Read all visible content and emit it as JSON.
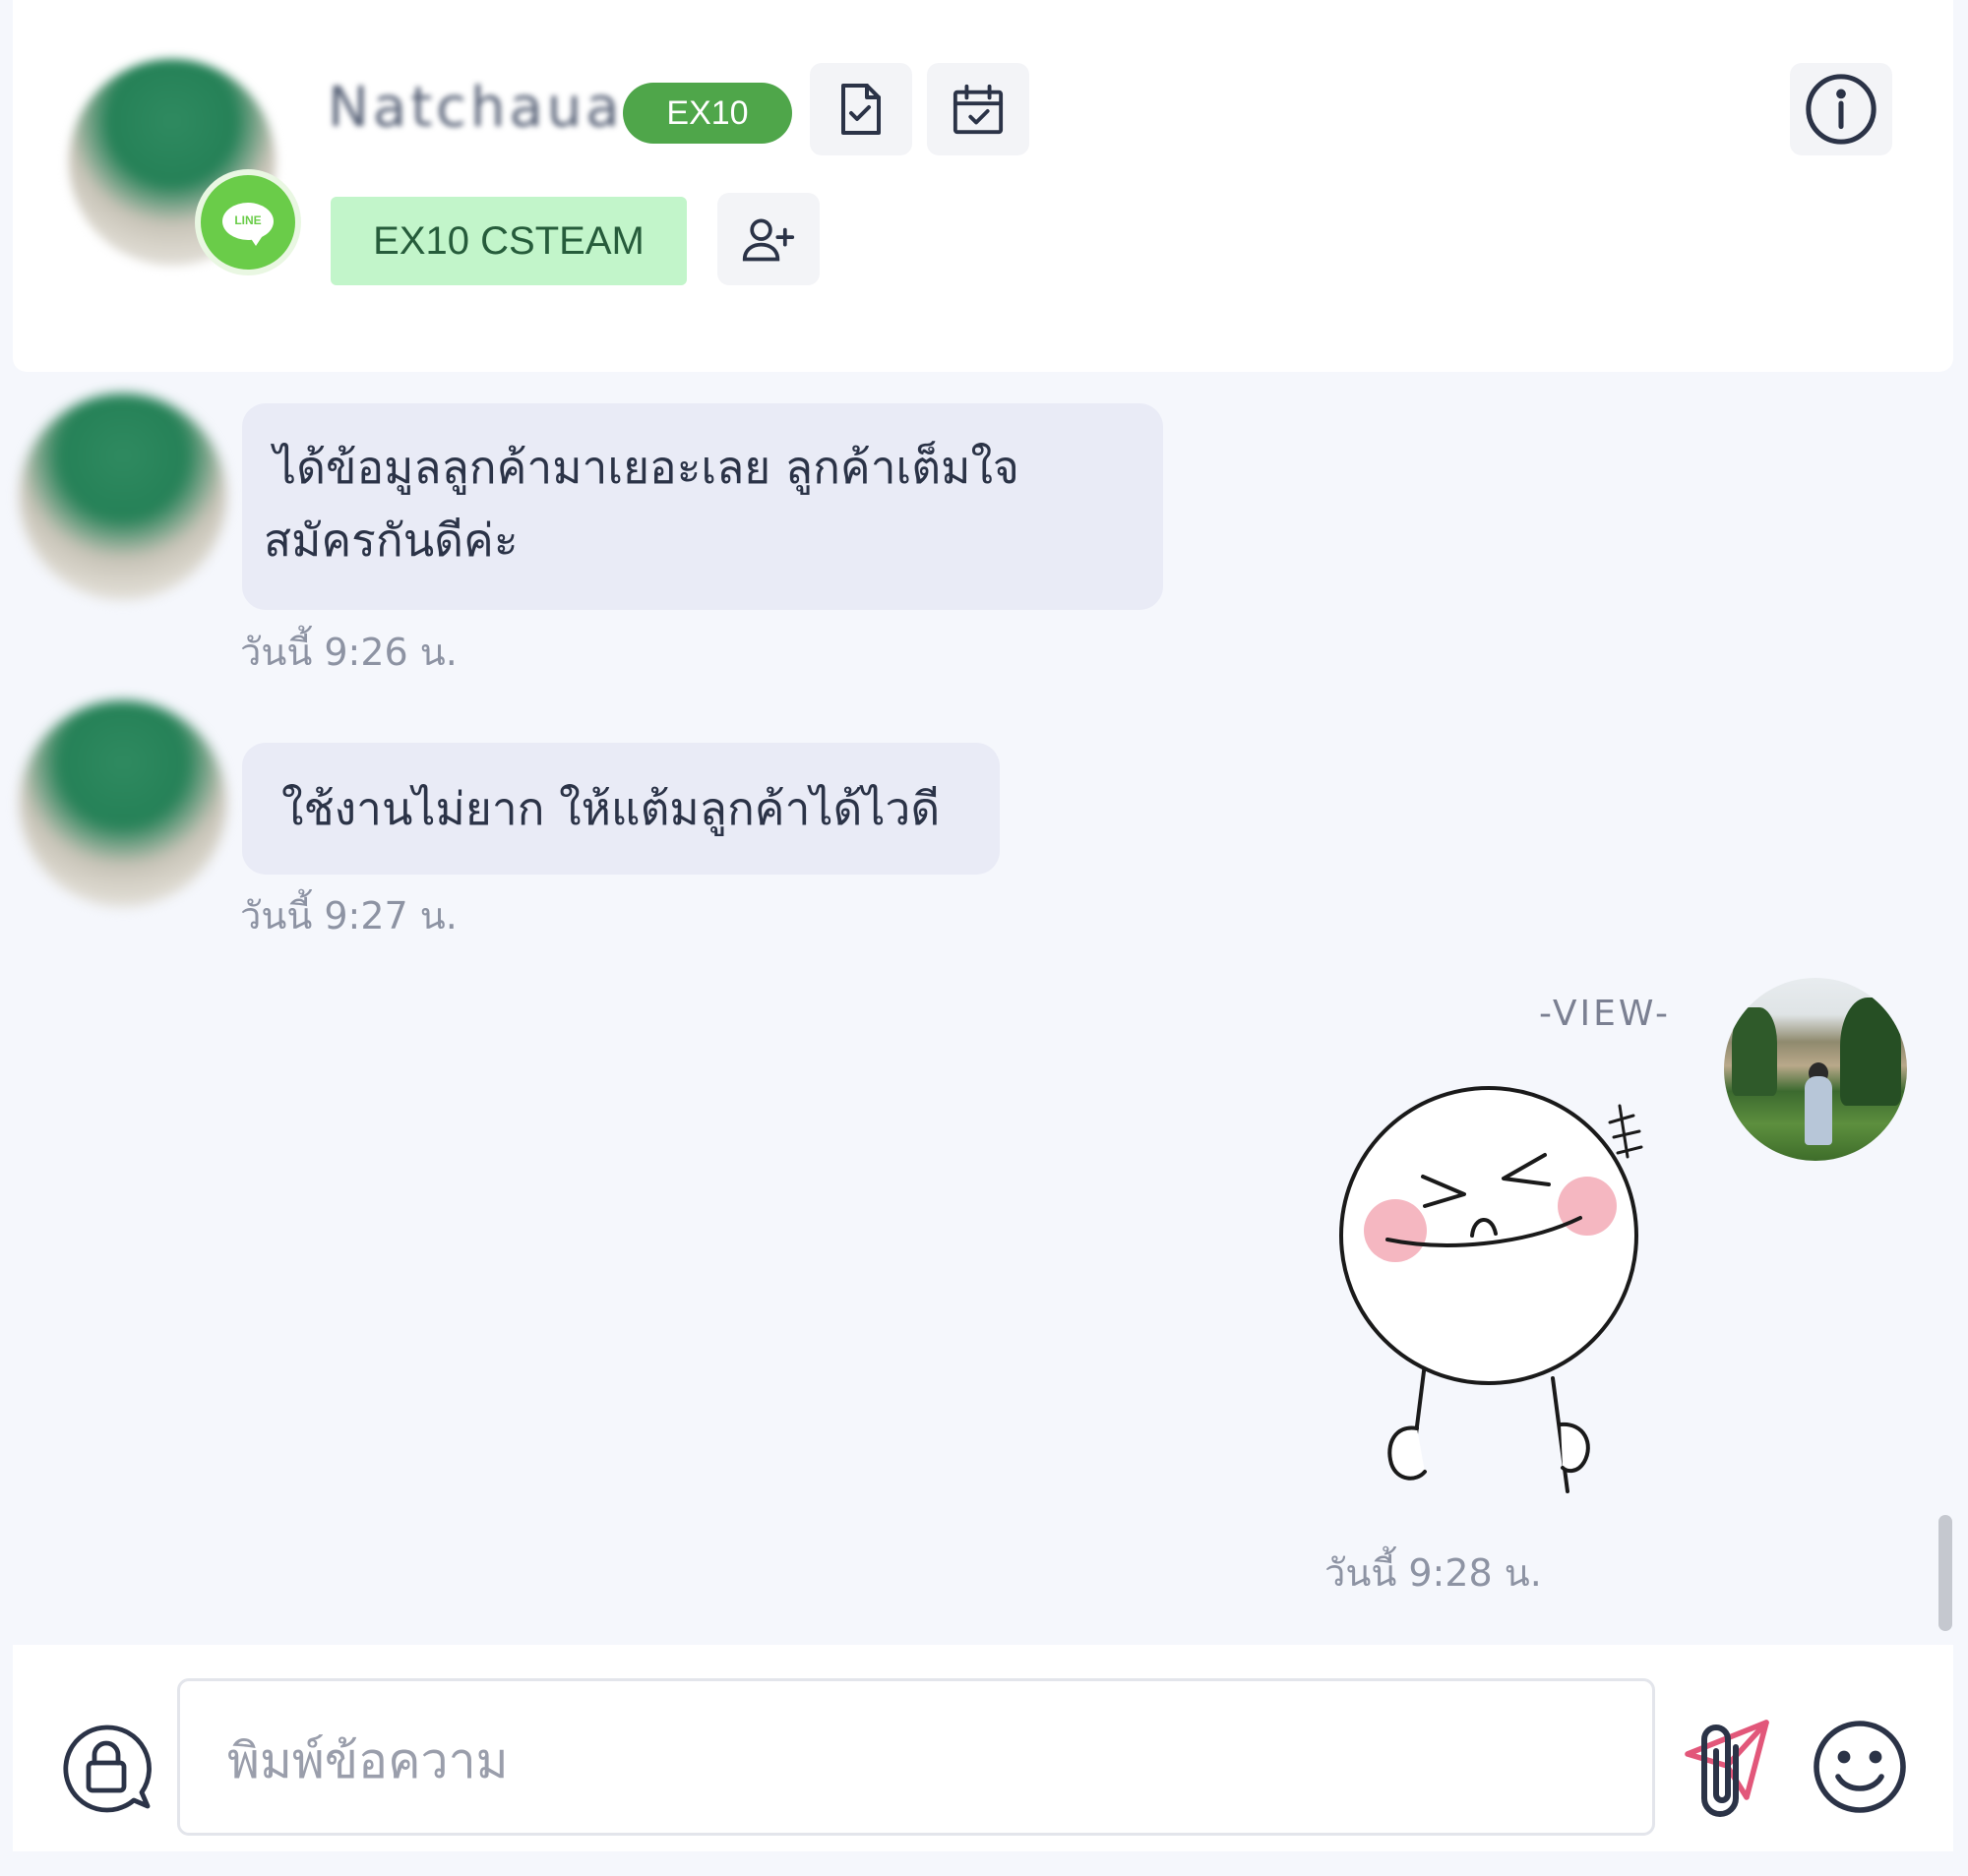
{
  "header": {
    "contact_name": "Natchaua",
    "tier_badge": "EX10",
    "team_tag": "EX10 CSTEAM",
    "channel_badge": "LINE",
    "icons": {
      "document": "document-check-icon",
      "calendar": "calendar-check-icon",
      "info": "info-icon",
      "add_user": "add-user-icon"
    }
  },
  "messages": [
    {
      "direction": "incoming",
      "lines": [
        "ได้ข้อมูลลูกค้ามาเยอะเลย ลูกค้าเต็มใจ",
        "สมัครกันดีค่ะ"
      ],
      "time": "วันนี้ 9:26 น."
    },
    {
      "direction": "incoming",
      "lines": [
        "ใช้งานไม่ยาก ให้แต้มลูกค้าได้ไวดี"
      ],
      "time": "วันนี้ 9:27 น."
    },
    {
      "direction": "outgoing",
      "sender": "-VIEW-",
      "type": "sticker",
      "time": "วันนี้ 9:28 น."
    }
  ],
  "composer": {
    "placeholder": "พิมพ์ข้อความ",
    "icons": {
      "private_note": "lock-chat-icon",
      "send": "send-icon",
      "attach": "paperclip-icon",
      "emoji": "smiley-icon"
    }
  },
  "colors": {
    "accent_green": "#4fa64a",
    "team_tag_bg": "#c2f5ca",
    "line_green": "#6acc49",
    "send_pink": "#e2577a",
    "incoming_bubble": "#e9ebf6",
    "chat_bg": "#f5f7fc"
  }
}
